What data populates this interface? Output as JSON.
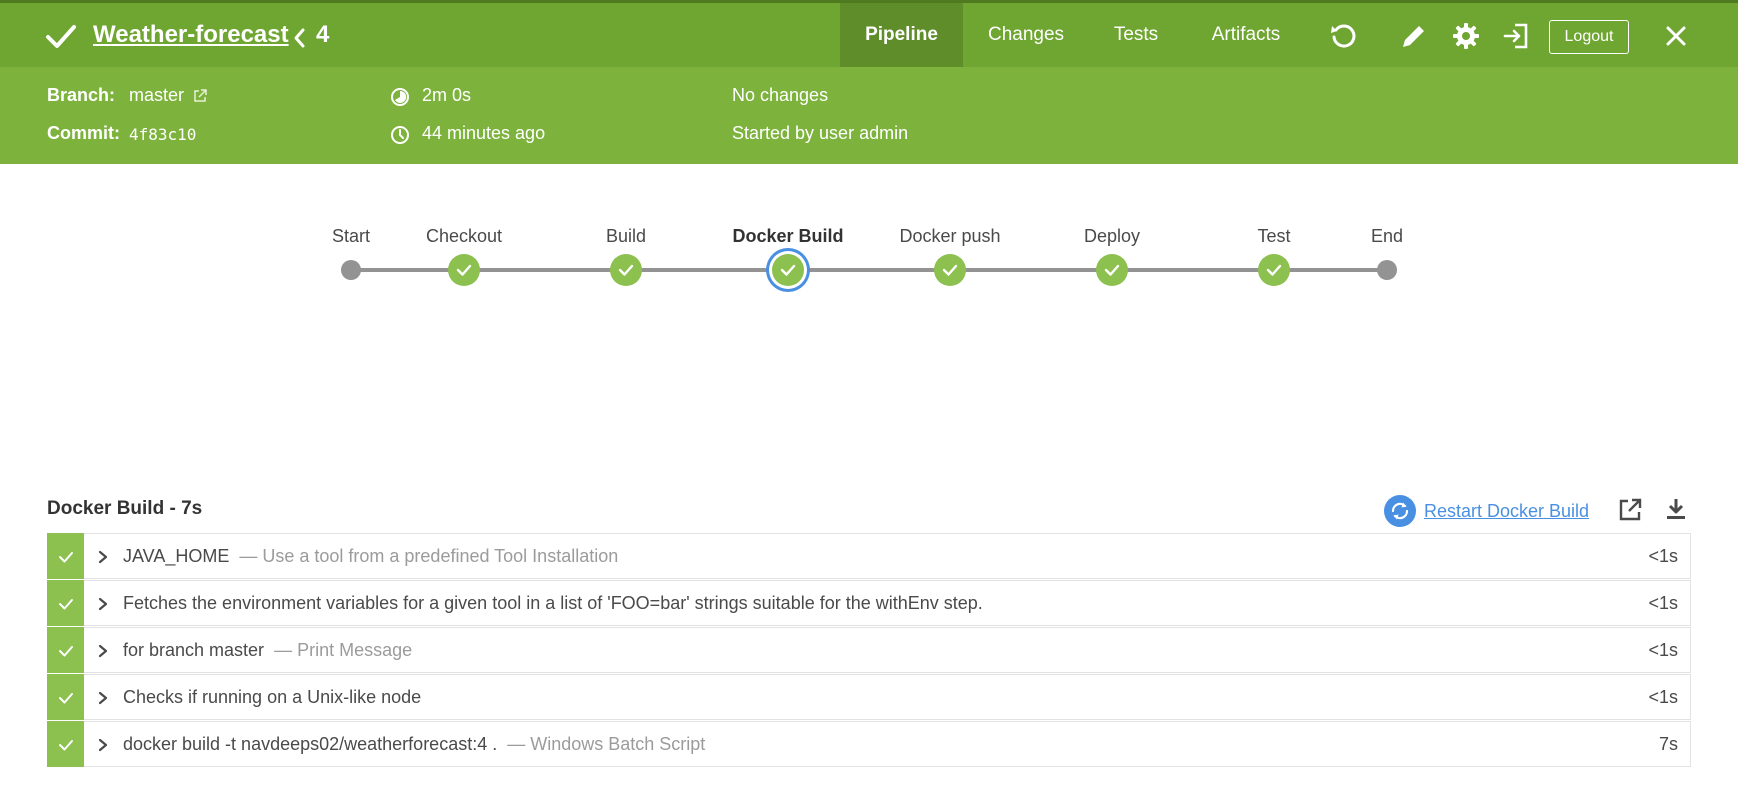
{
  "header": {
    "title": "Weather-forecast",
    "run_number": "4",
    "tabs": [
      {
        "label": "Pipeline",
        "active": true
      },
      {
        "label": "Changes",
        "active": false
      },
      {
        "label": "Tests",
        "active": false
      },
      {
        "label": "Artifacts",
        "active": false
      }
    ],
    "icons": [
      "replay-icon",
      "edit-icon",
      "gear-icon",
      "exit-icon",
      "close-icon"
    ],
    "logout_label": "Logout"
  },
  "summary": {
    "branch_label": "Branch:",
    "branch_value": "master",
    "commit_label": "Commit:",
    "commit_value": "4f83c10",
    "duration": "2m 0s",
    "time_ago": "44 minutes ago",
    "changes": "No changes",
    "started_by": "Started by user admin"
  },
  "pipeline": {
    "stages": [
      {
        "label": "Start",
        "kind": "terminal"
      },
      {
        "label": "Checkout",
        "kind": "success"
      },
      {
        "label": "Build",
        "kind": "success"
      },
      {
        "label": "Docker Build",
        "kind": "success",
        "selected": true
      },
      {
        "label": "Docker push",
        "kind": "success"
      },
      {
        "label": "Deploy",
        "kind": "success"
      },
      {
        "label": "Test",
        "kind": "success"
      },
      {
        "label": "End",
        "kind": "terminal"
      }
    ]
  },
  "steps": {
    "title": "Docker Build - 7s",
    "restart_label": "Restart Docker Build",
    "rows": [
      {
        "name": "JAVA_HOME",
        "desc": "— Use a tool from a predefined Tool Installation",
        "duration": "<1s"
      },
      {
        "name": "Fetches the environment variables for a given tool in a list of 'FOO=bar' strings suitable for the withEnv step.",
        "desc": "",
        "duration": "<1s"
      },
      {
        "name": "for branch master",
        "desc": "— Print Message",
        "duration": "<1s"
      },
      {
        "name": "Checks if running on a Unix-like node",
        "desc": "",
        "duration": "<1s"
      },
      {
        "name": "docker build -t navdeeps02/weatherforecast:4 .",
        "desc": "— Windows Batch Script",
        "duration": "7s"
      }
    ]
  },
  "colors": {
    "header_green": "#6fa531",
    "summary_green": "#7db33d",
    "success_green": "#8cc04f",
    "selected_blue": "#4a90e2",
    "rail_gray": "#949393"
  }
}
